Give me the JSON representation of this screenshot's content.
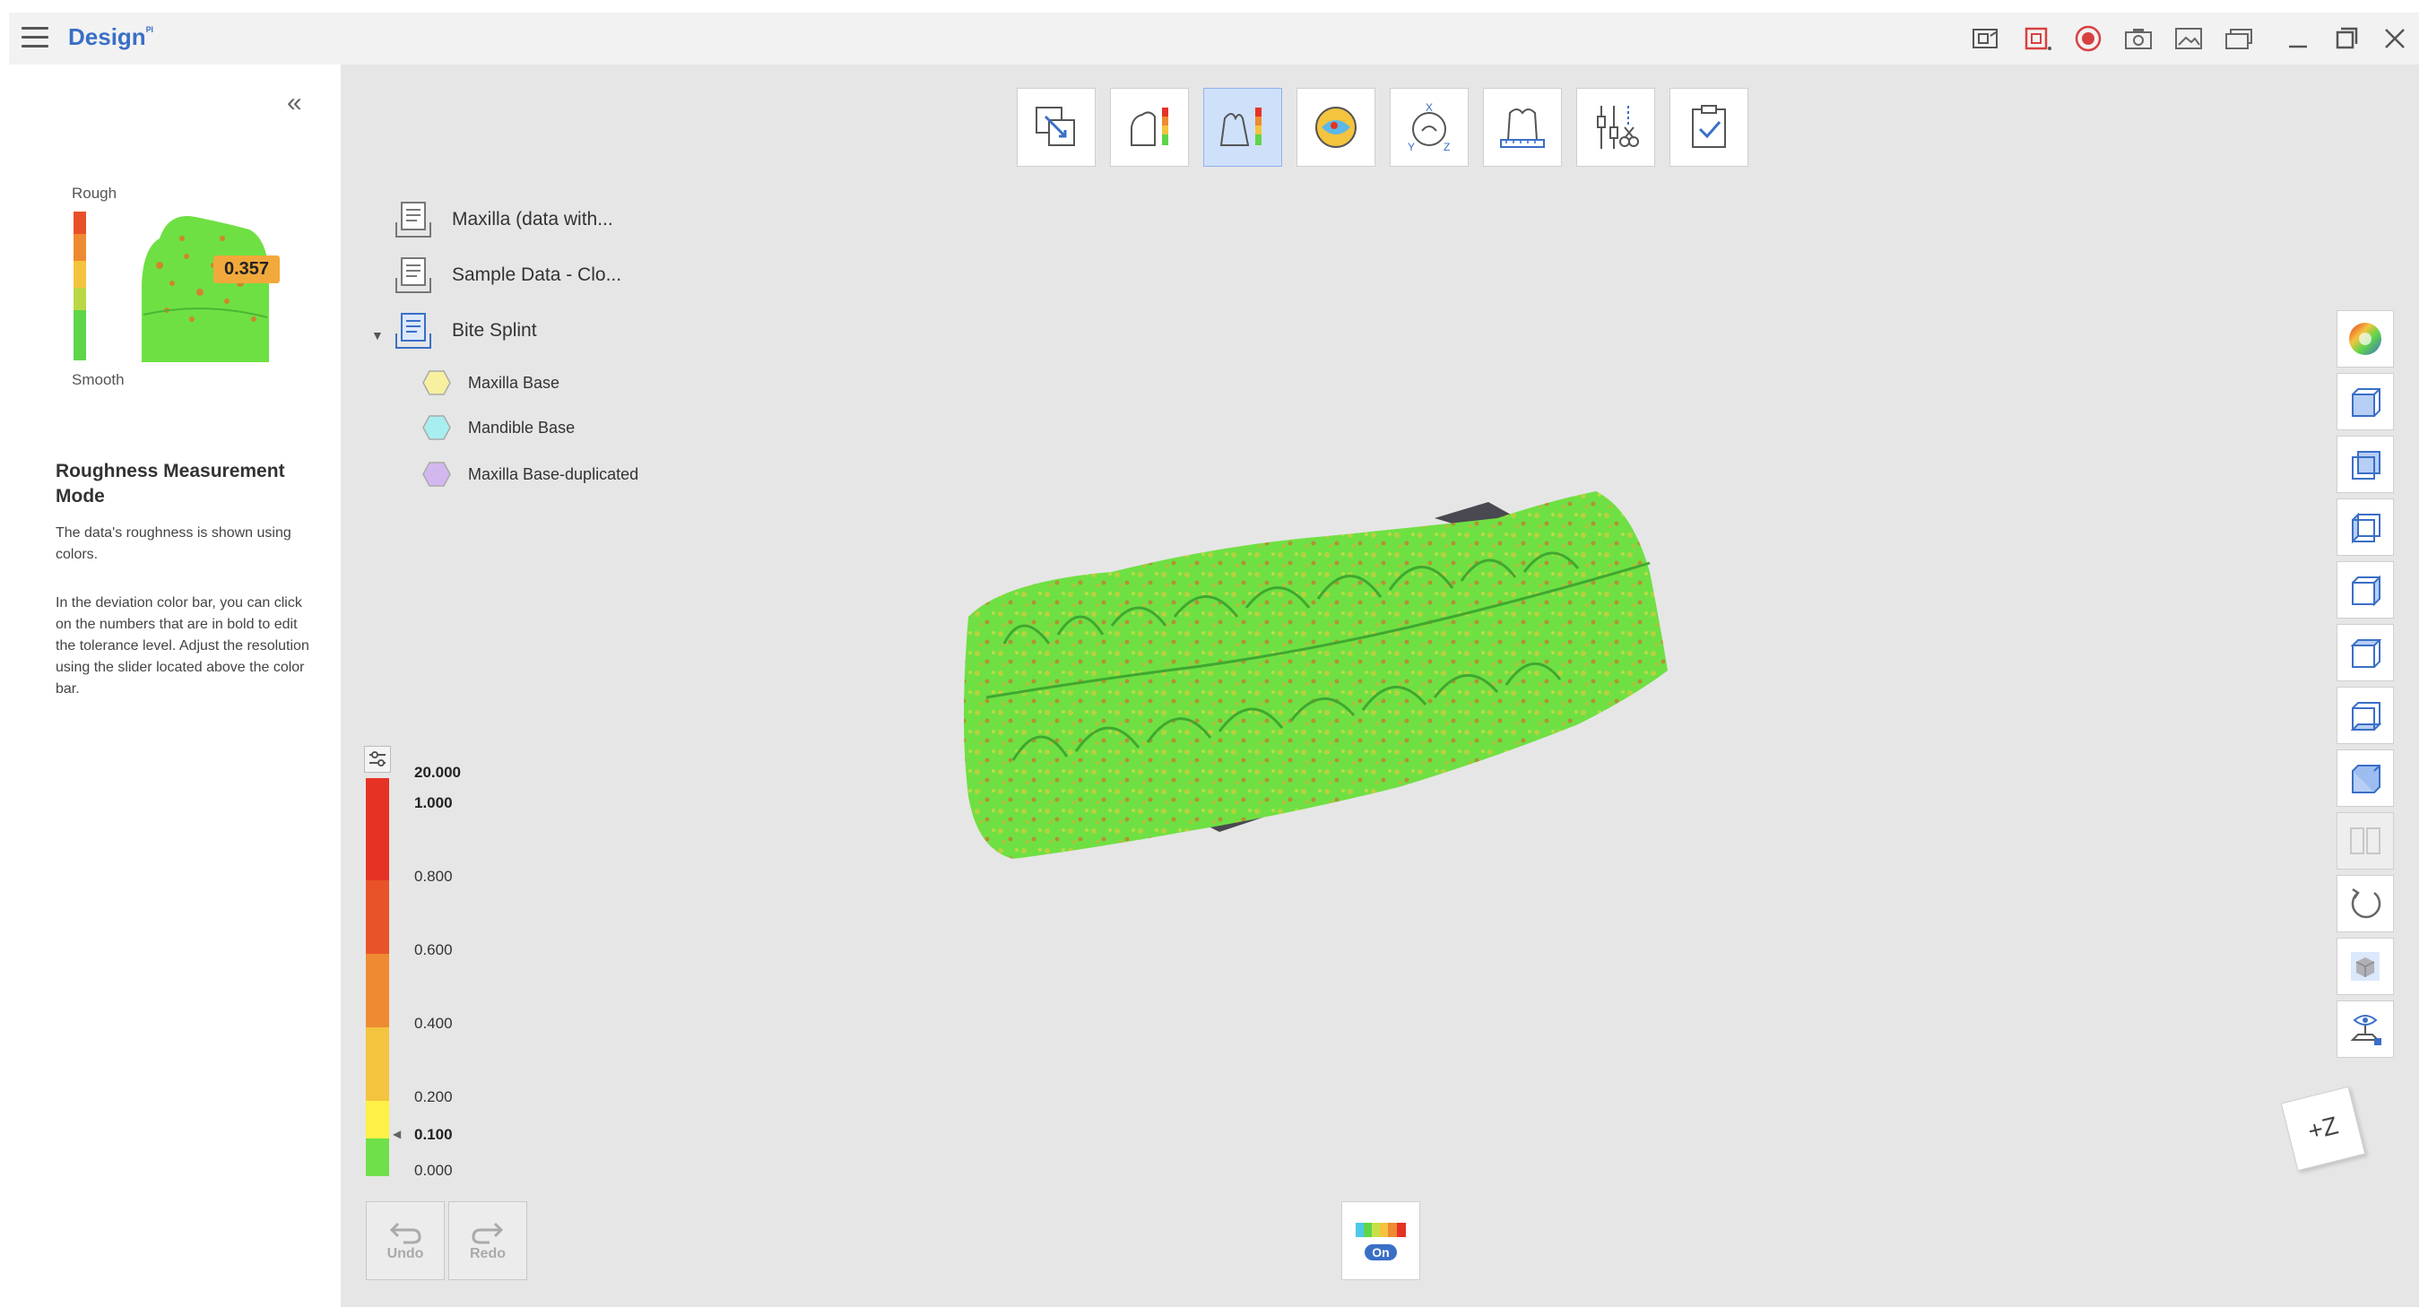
{
  "app": {
    "title": "Design",
    "title_badge": "ᴾᴵ"
  },
  "window_controls": [
    "layout-icon",
    "record-region-icon",
    "record-icon",
    "camera-icon",
    "image-icon",
    "gallery-icon",
    "minimize-icon",
    "maximize-icon",
    "close-icon"
  ],
  "left_panel": {
    "preview": {
      "rough_label": "Rough",
      "smooth_label": "Smooth",
      "value_badge": "0.357"
    },
    "help": {
      "title": "Roughness Measurement Mode",
      "paragraph1": "The data's roughness is shown using colors.",
      "paragraph2": "In the deviation color bar, you can click on the numbers that are in bold to edit the tolerance level. Adjust the resolution using the slider located above the color bar."
    }
  },
  "toolbar": {
    "tools": [
      "move-icon",
      "deviation-icon",
      "roughness-icon",
      "occlusion-icon",
      "axis-rotation-icon",
      "measure-icon",
      "trim-tools-icon",
      "complete-icon"
    ],
    "active_index": 2
  },
  "data_tree": {
    "items": [
      {
        "label": "Maxilla (data with..."
      },
      {
        "label": "Sample Data - Clo..."
      },
      {
        "label": "Bite Splint",
        "expanded": true,
        "children": [
          {
            "label": "Maxilla Base",
            "color": "#f7f0a0"
          },
          {
            "label": "Mandible Base",
            "color": "#a8eef0"
          },
          {
            "label": "Maxilla Base-duplicated",
            "color": "#d3b8f0"
          }
        ]
      }
    ]
  },
  "color_bar": {
    "labels": [
      {
        "text": "20.000",
        "bold": true
      },
      {
        "text": "1.000",
        "bold": true
      },
      {
        "text": "0.800",
        "bold": false
      },
      {
        "text": "0.600",
        "bold": false
      },
      {
        "text": "0.400",
        "bold": false
      },
      {
        "text": "0.200",
        "bold": false
      },
      {
        "text": "0.100",
        "bold": true
      },
      {
        "text": "0.000",
        "bold": false
      }
    ],
    "colors": [
      "#e63225",
      "#e63225",
      "#e8532a",
      "#ee8a32",
      "#f4c43e",
      "#fff045",
      "#6fe04a"
    ]
  },
  "history": {
    "undo_label": "Undo",
    "redo_label": "Redo"
  },
  "colormap_toggle": {
    "state_label": "On"
  },
  "side_tools": [
    "color-wheel-icon",
    "view-front-icon",
    "view-back-icon",
    "view-left-icon",
    "view-right-icon",
    "view-top-icon",
    "view-bottom-icon",
    "view-iso-icon",
    "split-view-icon",
    "rotate-icon",
    "solid-view-icon",
    "visibility-icon"
  ],
  "axis_indicator": {
    "label": "+Z"
  }
}
